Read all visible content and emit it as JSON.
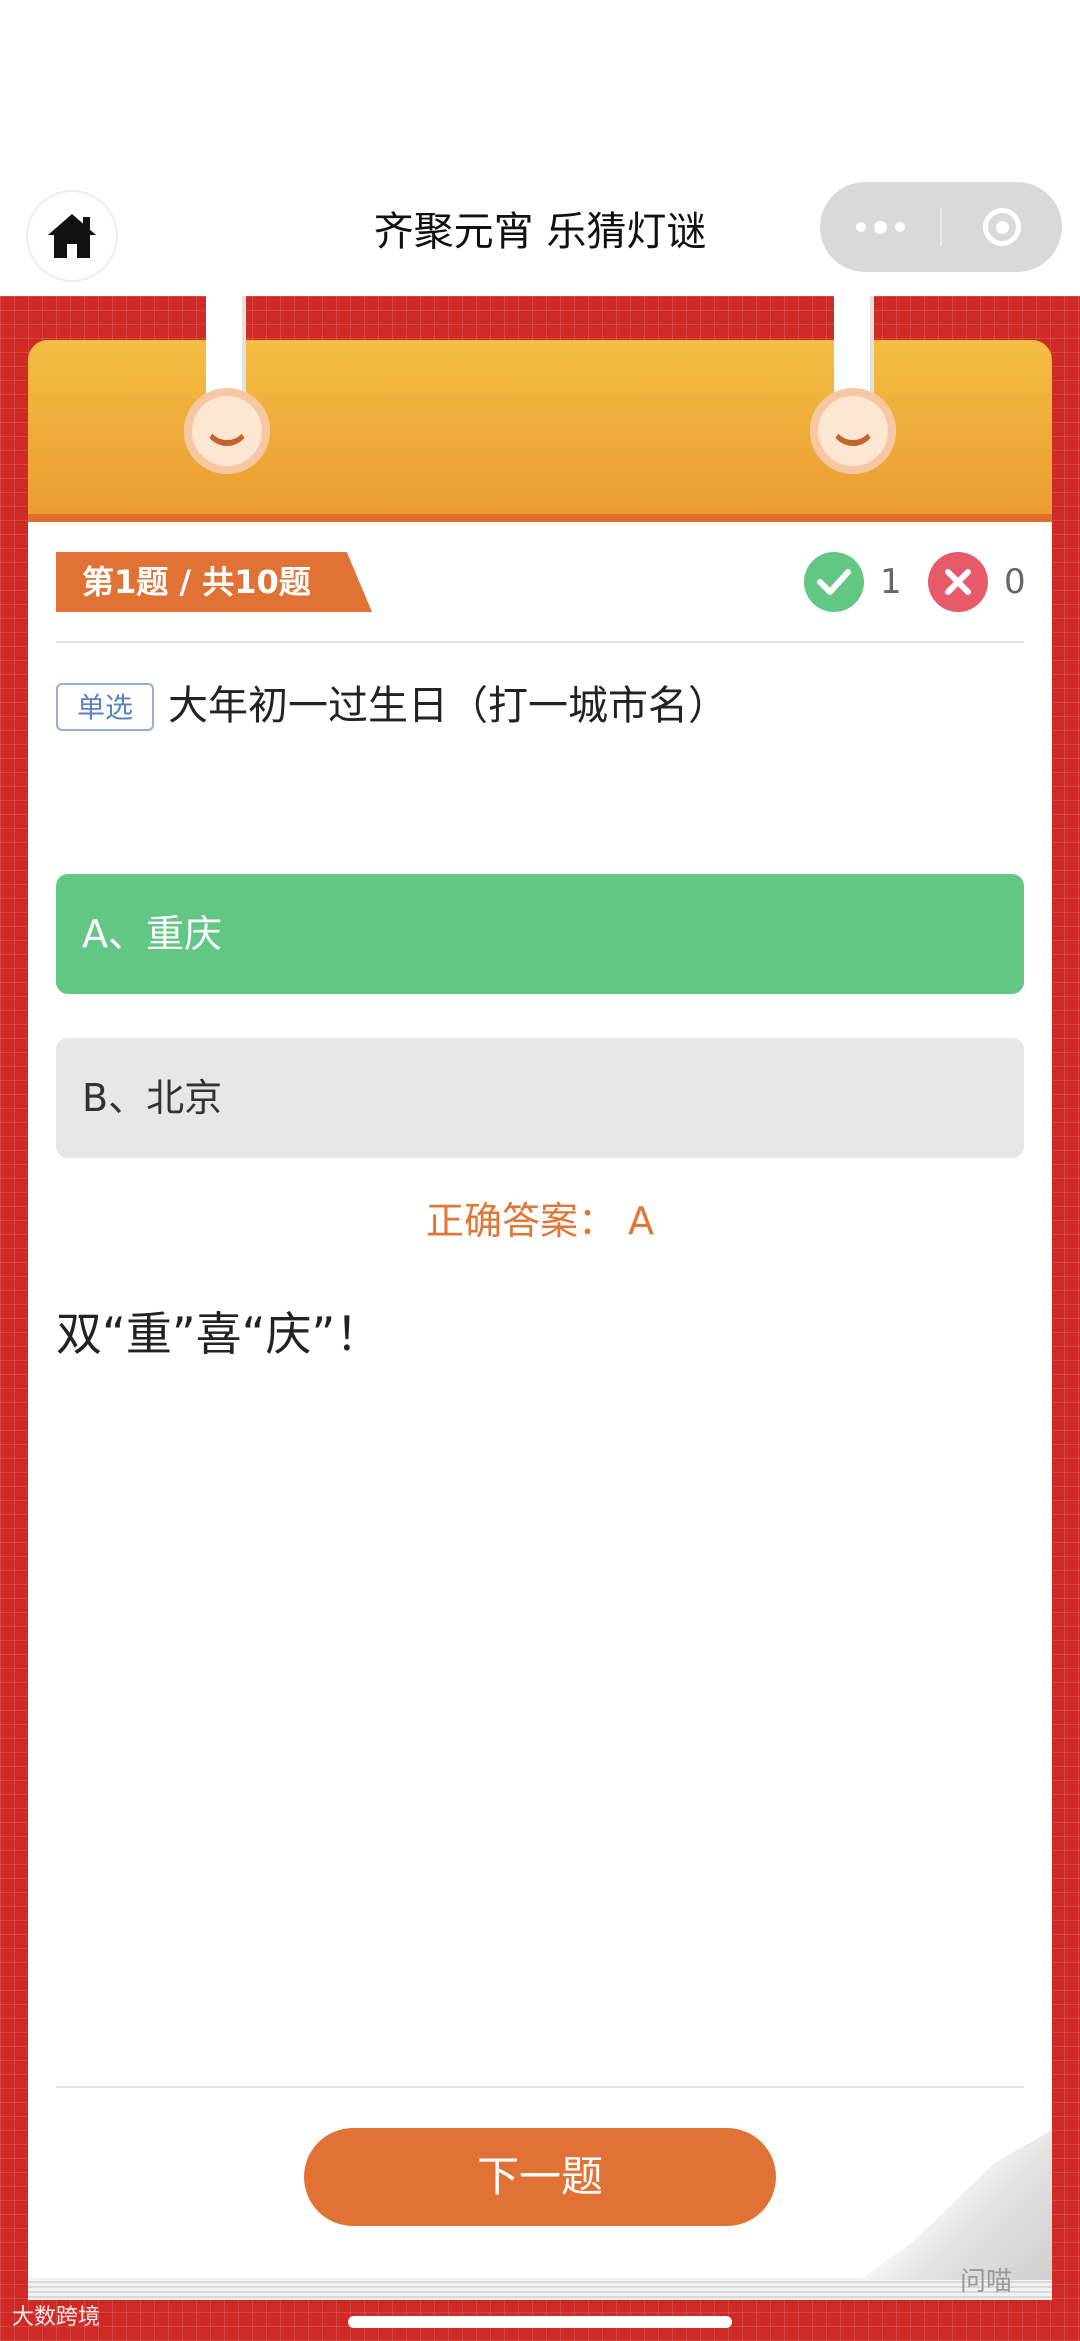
{
  "app": {
    "title": "齐聚元宵 乐猜灯谜"
  },
  "quiz": {
    "progress_label": "第1题 / 共10题",
    "correct_count": "1",
    "wrong_count": "0",
    "question_type": "单选",
    "question_text": "大年初一过生日（打一城市名）",
    "options": [
      {
        "label": "A、重庆",
        "state": "correct"
      },
      {
        "label": "B、北京",
        "state": "normal"
      }
    ],
    "answer_label": "正确答案：  A",
    "explanation": "双“重”喜“庆”！",
    "next_button": "下一题"
  },
  "watermarks": {
    "left": "大数跨境",
    "right": "问喵"
  },
  "colors": {
    "accent_orange": "#e07236",
    "correct_green": "#62c784",
    "wrong_red": "#e65a6a",
    "background_red": "#cf2a26"
  },
  "icons": {
    "home": "home-icon",
    "more": "more-dots-icon",
    "close": "close-circle-icon",
    "correct": "check-icon",
    "wrong": "cross-icon"
  }
}
